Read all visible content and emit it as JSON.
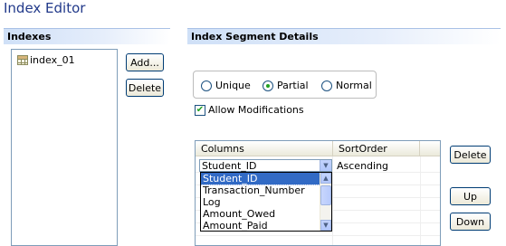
{
  "editor": {
    "title": "Index Editor"
  },
  "indexes": {
    "header": "Indexes",
    "items": [
      {
        "label": "index_01",
        "icon": "table-icon"
      }
    ],
    "add_label": "Add...",
    "delete_label": "Delete"
  },
  "segment": {
    "header": "Index Segment Details",
    "index_type": {
      "options": [
        "Unique",
        "Partial",
        "Normal"
      ],
      "selected": "Partial"
    },
    "allow_modifications": {
      "label": "Allow Modifications",
      "checked": true
    },
    "grid": {
      "headers": [
        "Columns",
        "SortOrder"
      ],
      "rows": [
        {
          "column": "Student_ID",
          "sort_order": "Ascending"
        }
      ]
    },
    "dropdown": {
      "options": [
        "Student_ID",
        "Transaction_Number",
        "Log",
        "Amount_Owed",
        "Amount_Paid"
      ],
      "selected": "Student_ID"
    },
    "delete_label": "Delete",
    "up_label": "Up",
    "down_label": "Down"
  },
  "colors": {
    "title": "#21398a",
    "selection": "#316ac5",
    "radio_dot": "#21a121"
  }
}
